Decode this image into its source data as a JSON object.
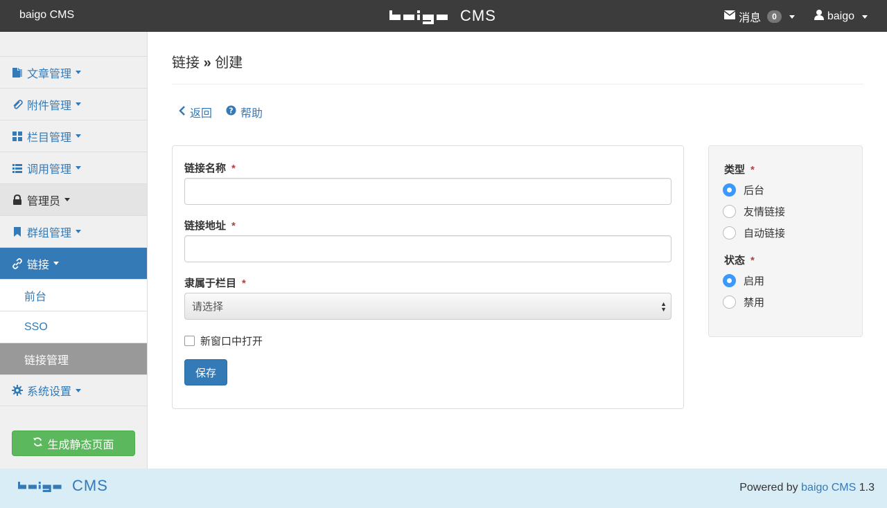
{
  "topbar": {
    "brand": "baigo CMS",
    "logo_text": "CMS",
    "messages_label": "消息",
    "messages_count": "0",
    "user_label": "baigo"
  },
  "sidebar": {
    "items": [
      {
        "label": "文章管理",
        "icon": "file-icon"
      },
      {
        "label": "附件管理",
        "icon": "paperclip-icon"
      },
      {
        "label": "栏目管理",
        "icon": "grid-icon"
      },
      {
        "label": "调用管理",
        "icon": "list-icon"
      },
      {
        "label": "管理员",
        "icon": "lock-icon"
      },
      {
        "label": "群组管理",
        "icon": "bookmark-icon"
      },
      {
        "label": "链接",
        "icon": "link-icon"
      }
    ],
    "sub_items": [
      {
        "label": "前台"
      },
      {
        "label": "SSO"
      },
      {
        "label": "链接管理"
      }
    ],
    "settings": {
      "label": "系统设置",
      "icon": "gear-icon"
    },
    "generate_button": "生成静态页面"
  },
  "main": {
    "title_part1": "链接",
    "title_sep": "»",
    "title_part2": "创建",
    "back_label": "返回",
    "help_label": "帮助",
    "form": {
      "name_label": "链接名称",
      "name_value": "",
      "url_label": "链接地址",
      "url_value": "",
      "category_label": "隶属于栏目",
      "category_selected": "请选择",
      "new_window_label": "新窗口中打开",
      "required_mark": "*",
      "save_label": "保存"
    },
    "side_panel": {
      "type_label": "类型",
      "type_options": [
        {
          "label": "后台",
          "checked": true
        },
        {
          "label": "友情链接",
          "checked": false
        },
        {
          "label": "自动链接",
          "checked": false
        }
      ],
      "status_label": "状态",
      "status_options": [
        {
          "label": "启用",
          "checked": true
        },
        {
          "label": "禁用",
          "checked": false
        }
      ]
    }
  },
  "footer": {
    "logo_text": "CMS",
    "powered_prefix": "Powered by",
    "powered_link": "baigo CMS",
    "version": "1.3"
  },
  "colors": {
    "topbar": "#3c3c3c",
    "primary": "#337ab7",
    "success": "#5cb85c",
    "footer": "#d9edf7",
    "required": "#a94442"
  }
}
